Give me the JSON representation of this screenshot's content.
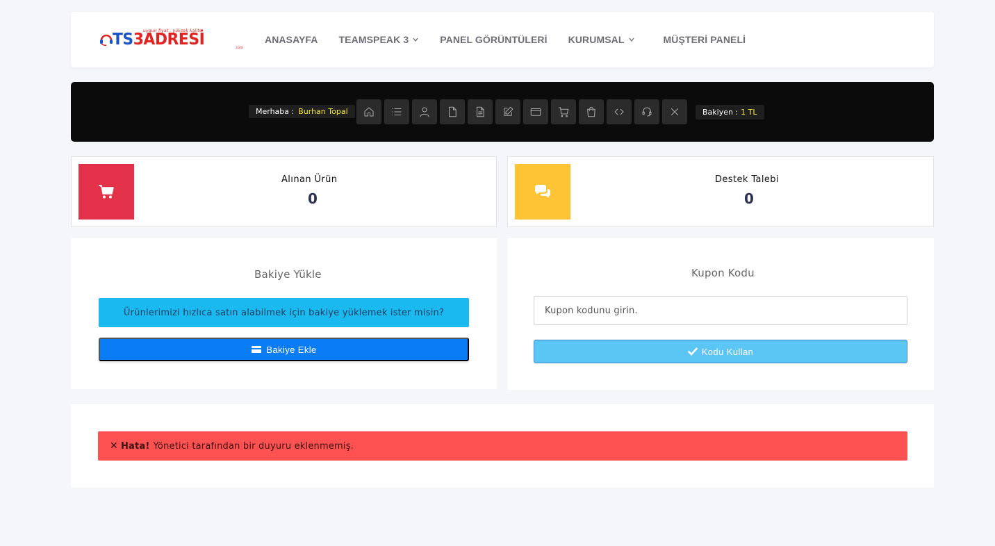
{
  "header": {
    "logo": {
      "tagline": "uygun fiyat , yüksek kalite",
      "word_ts": "TS",
      "word_rest": "3ADRESİ",
      "domain_suffix": ".com"
    },
    "nav": [
      {
        "label": "ANASAYFA",
        "dropdown": false
      },
      {
        "label": "TEAMSPEAK 3",
        "dropdown": true
      },
      {
        "label": "PANEL GÖRÜNTÜLERİ",
        "dropdown": false
      },
      {
        "label": "KURUMSAL",
        "dropdown": true
      },
      {
        "label": "MÜŞTERİ PANELİ",
        "dropdown": false
      }
    ]
  },
  "userbar": {
    "greeting_label": "Merhaba :",
    "user_name": "Burhan Topal",
    "balance_label": "Bakiyen :",
    "balance_value": "1 TL",
    "icons": [
      "home-icon",
      "list-icon",
      "user-icon",
      "file-icon",
      "document-icon",
      "edit-icon",
      "credit-card-icon",
      "cart-icon",
      "shopping-bag-icon",
      "code-icon",
      "support-icon",
      "close-icon"
    ]
  },
  "stats": [
    {
      "label": "Alınan Ürün",
      "value": "0",
      "color": "#e3314a",
      "icon": "cart-icon"
    },
    {
      "label": "Destek Talebi",
      "value": "0",
      "color": "#ffc436",
      "icon": "comments-icon"
    }
  ],
  "balance_card": {
    "title": "Bakiye Yükle",
    "info_text": "Ürünlerimizi hızlıca satın alabilmek için bakiye yüklemek ister misin?",
    "button_label": "Bakiye Ekle"
  },
  "coupon_card": {
    "title": "Kupon Kodu",
    "input_placeholder": "Kupon kodunu girin.",
    "button_label": "Kodu Kullan"
  },
  "announcement": {
    "error_title": "Hata!",
    "error_text": "Yönetici tarafından bir duyuru eklenmemiş."
  },
  "colors": {
    "accent_blue": "#0a7cf5",
    "info_blue": "#1ab9f0",
    "danger_red": "#fe5152",
    "highlight_yellow": "#f5e63b"
  }
}
